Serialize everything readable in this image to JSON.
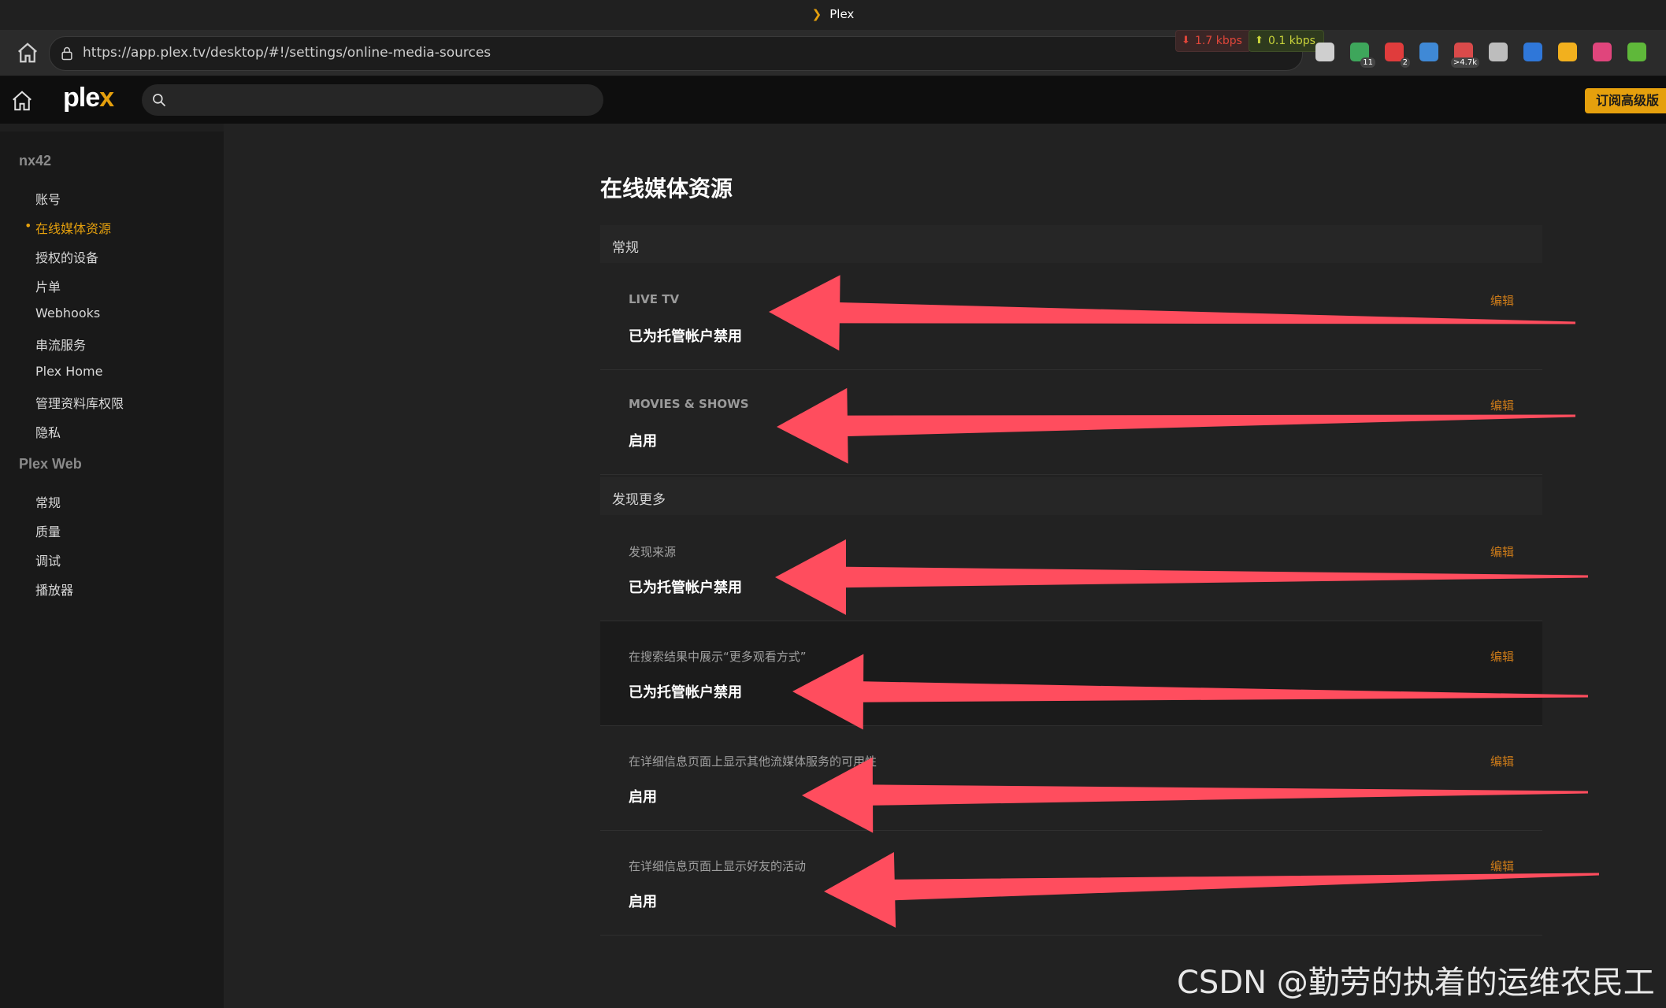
{
  "window": {
    "title": "Plex"
  },
  "browser": {
    "url": "https://app.plex.tv/desktop/#!/settings/online-media-sources",
    "download_speed": "1.7 kbps",
    "upload_speed": "0.1 kbps",
    "extensions": [
      {
        "icon": "container-icon",
        "color": "#cfcfcf",
        "count": ""
      },
      {
        "icon": "chat-icon",
        "color": "#3ea65b",
        "count": "11"
      },
      {
        "icon": "adblock-icon",
        "color": "#e03c3c",
        "count": "2"
      },
      {
        "icon": "translate-icon",
        "color": "#3f89d6",
        "count": ""
      },
      {
        "icon": "mail-icon",
        "color": "#d94a4a",
        "count": ">4.7k"
      },
      {
        "icon": "reader-icon",
        "color": "#bdbdbd",
        "count": ""
      },
      {
        "icon": "bookmark-icon",
        "color": "#2f77d9",
        "count": ""
      },
      {
        "icon": "clock-icon",
        "color": "#f2b01e",
        "count": ""
      },
      {
        "icon": "lang-icon",
        "color": "#e0457c",
        "count": ""
      },
      {
        "icon": "leaf-icon",
        "color": "#5fb83a",
        "count": ""
      }
    ]
  },
  "header": {
    "logo_main": "ple",
    "logo_accent": "x",
    "search_placeholder": "",
    "premium_label": "订阅高级版"
  },
  "sidebar": {
    "account_group": "nx42",
    "account_items": [
      "账号",
      "在线媒体资源",
      "授权的设备",
      "片单",
      "Webhooks",
      "串流服务",
      "Plex Home",
      "管理资料库权限",
      "隐私"
    ],
    "active_item": "在线媒体资源",
    "web_group": "Plex Web",
    "web_items": [
      "常规",
      "质量",
      "调试",
      "播放器"
    ]
  },
  "main": {
    "title": "在线媒体资源",
    "sections": [
      {
        "header": "常规",
        "rows": [
          {
            "label": "LIVE TV",
            "value": "已为托管帐户禁用",
            "edit": "编辑"
          },
          {
            "label": "MOVIES & SHOWS",
            "value": "启用",
            "edit": "编辑"
          }
        ]
      },
      {
        "header": "发现更多",
        "rows": [
          {
            "label": "发现来源",
            "value": "已为托管帐户禁用",
            "edit": "编辑"
          },
          {
            "label": "在搜索结果中展示“更多观看方式”",
            "value": "已为托管帐户禁用",
            "edit": "编辑"
          },
          {
            "label": "在详细信息页面上显示其他流媒体服务的可用性",
            "value": "启用",
            "edit": "编辑"
          },
          {
            "label": "在详细信息页面上显示好友的活动",
            "value": "启用",
            "edit": "编辑"
          }
        ]
      }
    ]
  },
  "annotation_color": "#ff4d5e",
  "watermark": "CSDN @勤劳的执着的运维农民工"
}
